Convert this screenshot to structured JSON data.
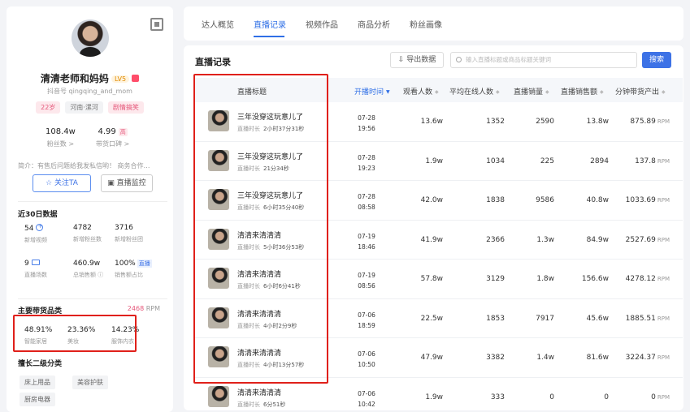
{
  "profile": {
    "name": "清清老师和妈妈",
    "level": "LV5",
    "douyin_id": "抖音号 qingqing_and_mom",
    "tags": [
      "22岁",
      "河南·漯河",
      "剧情搞笑"
    ],
    "fans": "108.4w",
    "fans_label": "粉丝数 >",
    "reputation": "4.99",
    "reputation_badge": "高",
    "reputation_label": "带货口碑 >",
    "intro": "简介：有售后问题给我发私信哟！ 商务合作…",
    "follow_label": "关注TA",
    "monitor_label": "直播监控"
  },
  "last30": {
    "title": "近30日数据",
    "items": [
      {
        "value": "54",
        "label": "新增视频"
      },
      {
        "value": "4782",
        "label": "新增粉丝数"
      },
      {
        "value": "3716",
        "label": "新增粉丝团"
      },
      {
        "value": "9",
        "label": "直播场数"
      },
      {
        "value": "460.9w",
        "label": "总销售额"
      },
      {
        "value": "100%",
        "badge": "直播",
        "label": "销售额占比"
      }
    ]
  },
  "categories": {
    "title": "主要带货品类",
    "rpm_value": "2468",
    "rpm_unit": "RPM",
    "items": [
      {
        "value": "48.91%",
        "label": "智能家居"
      },
      {
        "value": "23.36%",
        "label": "美妆"
      },
      {
        "value": "14.23%",
        "label": "服饰内衣"
      }
    ]
  },
  "secondary": {
    "title": "擅长二级分类",
    "tags": [
      "床上用品",
      "美容护肤",
      "厨房电器"
    ]
  },
  "tabs": [
    "达人概览",
    "直播记录",
    "视频作品",
    "商品分析",
    "粉丝画像"
  ],
  "active_tab": "直播记录",
  "live": {
    "title": "直播记录",
    "export_label": "导出数据",
    "search_placeholder": "输入直播标题或商品标题关键词",
    "search_label": "搜索",
    "columns": [
      "直播标题",
      "开播时间",
      "观看人数",
      "平均在线人数",
      "直播销量",
      "直播销售额",
      "分钟带货产出"
    ],
    "duration_label": "直播时长",
    "rpm_unit": "RPM",
    "rows": [
      {
        "title": "三年没穿这玩意儿了",
        "duration": "2小时37分31秒",
        "date": "07-28",
        "time": "19:56",
        "views": "13.6w",
        "avg_online": "1352",
        "sales": "2590",
        "revenue": "13.8w",
        "per_min": "875.89"
      },
      {
        "title": "三年没穿这玩意儿了",
        "duration": "21分34秒",
        "date": "07-28",
        "time": "19:23",
        "views": "1.9w",
        "avg_online": "1034",
        "sales": "225",
        "revenue": "2894",
        "per_min": "137.8"
      },
      {
        "title": "三年没穿这玩意儿了",
        "duration": "6小时35分40秒",
        "date": "07-28",
        "time": "08:58",
        "views": "42.0w",
        "avg_online": "1838",
        "sales": "9586",
        "revenue": "40.8w",
        "per_min": "1033.69"
      },
      {
        "title": "清清来清清清",
        "duration": "5小时36分53秒",
        "date": "07-19",
        "time": "18:46",
        "views": "41.9w",
        "avg_online": "2366",
        "sales": "1.3w",
        "revenue": "84.9w",
        "per_min": "2527.69"
      },
      {
        "title": "清清来清清清",
        "duration": "6小时6分41秒",
        "date": "07-19",
        "time": "08:56",
        "views": "57.8w",
        "avg_online": "3129",
        "sales": "1.8w",
        "revenue": "156.6w",
        "per_min": "4278.12"
      },
      {
        "title": "清清来清清清",
        "duration": "4小时2分9秒",
        "date": "07-06",
        "time": "18:59",
        "views": "22.5w",
        "avg_online": "1853",
        "sales": "7917",
        "revenue": "45.6w",
        "per_min": "1885.51"
      },
      {
        "title": "清清来清清清",
        "duration": "4小时13分57秒",
        "date": "07-06",
        "time": "10:50",
        "views": "47.9w",
        "avg_online": "3382",
        "sales": "1.4w",
        "revenue": "81.6w",
        "per_min": "3224.37"
      },
      {
        "title": "清清来清清清",
        "duration": "6分51秒",
        "date": "07-06",
        "time": "10:42",
        "views": "1.9w",
        "avg_online": "333",
        "sales": "0",
        "revenue": "0",
        "per_min": "0"
      }
    ]
  },
  "colors": {
    "accent": "#2f6fe6",
    "highlight_box": "#e0201a",
    "pink": "#e5577a"
  }
}
